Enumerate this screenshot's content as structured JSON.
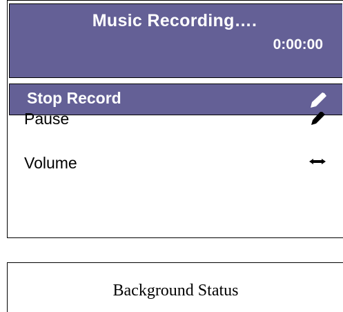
{
  "header": {
    "title": "Music Recording….",
    "timer": "0:00:00"
  },
  "menu": {
    "items": [
      {
        "label": "Stop Record",
        "selected": true,
        "icon": "pencil-icon"
      },
      {
        "label": "Pause",
        "selected": false,
        "icon": "pencil-icon"
      },
      {
        "label": "Volume",
        "selected": false,
        "icon": "double-arrow-icon"
      }
    ]
  },
  "status": {
    "label": "Background Status"
  },
  "colors": {
    "accent": "#646096",
    "text_on_accent": "#ffffff",
    "border": "#000000"
  }
}
